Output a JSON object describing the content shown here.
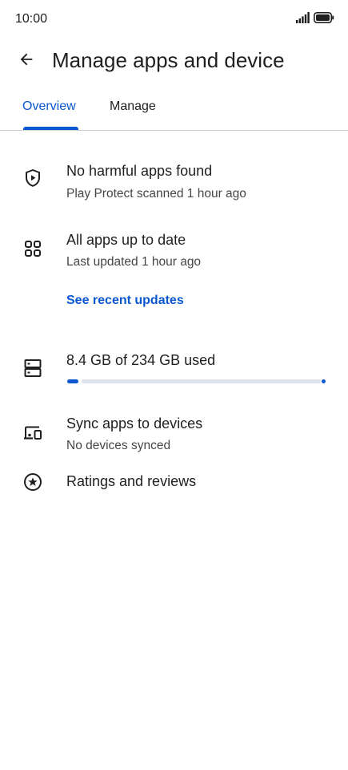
{
  "status_bar": {
    "time": "10:00",
    "signal_icon": "signal-icon",
    "battery_icon": "battery-icon"
  },
  "header": {
    "back_icon": "arrow-back-icon",
    "title": "Manage apps and device"
  },
  "tabs": [
    {
      "label": "Overview",
      "selected": true
    },
    {
      "label": "Manage",
      "selected": false
    }
  ],
  "overview": {
    "protect": {
      "icon": "shield-play-icon",
      "title": "No harmful apps found",
      "subtitle": "Play Protect scanned 1 hour ago"
    },
    "updates": {
      "icon": "apps-grid-icon",
      "title": "All apps up to date",
      "subtitle": "Last updated 1 hour ago",
      "link": "See recent updates"
    },
    "storage": {
      "icon": "storage-icon",
      "title": "8.4 GB of 234 GB used",
      "used_gb": 8.4,
      "total_gb": 234
    },
    "sync": {
      "icon": "devices-icon",
      "title": "Sync apps to devices",
      "subtitle": "No devices synced"
    },
    "ratings": {
      "icon": "star-circle-icon",
      "title": "Ratings and reviews"
    }
  },
  "colors": {
    "accent": "#0b57d0",
    "text_primary": "#1f1f1f",
    "text_secondary": "#444746",
    "track": "#dde3ea",
    "divider": "#c9ccd1"
  }
}
